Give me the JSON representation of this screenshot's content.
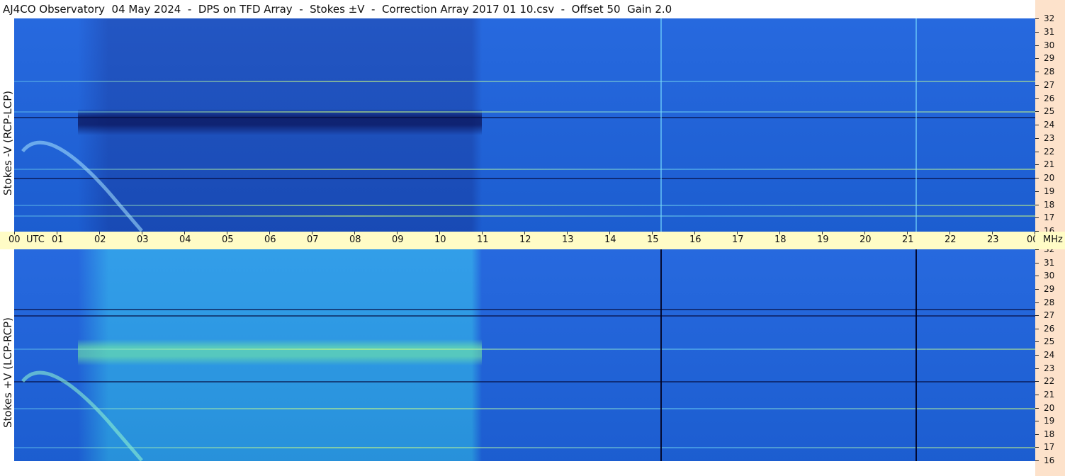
{
  "title": "AJ4CO Observatory  04 May 2024  -  DPS on TFD Array  -  Stokes ±V  -  Correction Array 2017 01 10.csv  -  Offset 50  Gain 2.0",
  "chart_data": [
    {
      "type": "heatmap",
      "panel": "top",
      "ylabel": "Stokes -V (RCP-LCP)",
      "x": [
        "00",
        "01",
        "02",
        "03",
        "04",
        "05",
        "06",
        "07",
        "08",
        "09",
        "10",
        "11",
        "12",
        "13",
        "14",
        "15",
        "16",
        "17",
        "18",
        "19",
        "20",
        "21",
        "22",
        "23",
        "00"
      ],
      "x_unit": "UTC",
      "y_ticks": [
        32,
        31,
        30,
        29,
        28,
        27,
        26,
        25,
        24,
        23,
        22,
        21,
        20,
        19,
        18,
        17,
        16
      ],
      "y_unit": "MHz",
      "ylim": [
        16,
        32
      ],
      "xlim": [
        0,
        24
      ],
      "background_color": "#1e63dd",
      "bright_bands_mhz": [
        27.3,
        25.0,
        20.7,
        18.0,
        17.2
      ],
      "dark_bands_mhz": [
        24.6,
        20.0
      ],
      "storm_window_utc": [
        1.5,
        11.0
      ],
      "interference_lines_utc": [
        15.2,
        21.2
      ],
      "burst_arc": "00-03 UTC, 24 MHz descending to 16 MHz"
    },
    {
      "type": "heatmap",
      "panel": "bottom",
      "ylabel": "Stokes +V (LCP-RCP)",
      "x": [
        "00",
        "01",
        "02",
        "03",
        "04",
        "05",
        "06",
        "07",
        "08",
        "09",
        "10",
        "11",
        "12",
        "13",
        "14",
        "15",
        "16",
        "17",
        "18",
        "19",
        "20",
        "21",
        "22",
        "23",
        "00"
      ],
      "x_unit": "UTC",
      "y_ticks": [
        32,
        31,
        30,
        29,
        28,
        27,
        26,
        25,
        24,
        23,
        22,
        21,
        20,
        19,
        18,
        17,
        16
      ],
      "y_unit": "MHz",
      "ylim": [
        16,
        32
      ],
      "xlim": [
        0,
        24
      ],
      "background_color": "#1e63dd",
      "bright_bands_mhz": [
        24.5,
        20.0,
        17.0
      ],
      "dark_bands_mhz": [
        27.5,
        27.0,
        22.0
      ],
      "storm_window_utc": [
        1.5,
        11.0
      ],
      "interference_lines_utc": [
        15.2,
        21.2
      ],
      "burst_arc": "00-03 UTC, 24 MHz descending to 16 MHz"
    }
  ],
  "time_axis": {
    "labels": [
      "00",
      "01",
      "02",
      "03",
      "04",
      "05",
      "06",
      "07",
      "08",
      "09",
      "10",
      "11",
      "12",
      "13",
      "14",
      "15",
      "16",
      "17",
      "18",
      "19",
      "20",
      "21",
      "22",
      "23",
      "00"
    ],
    "utc_label": "UTC",
    "mhz_label": "MHz"
  }
}
